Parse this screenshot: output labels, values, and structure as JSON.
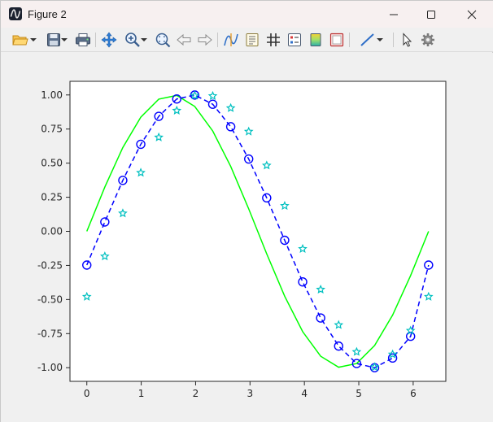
{
  "window": {
    "title": "Figure 2"
  },
  "toolbar": {
    "buttons": [
      {
        "name": "open-file-button",
        "icon": "folder-open-icon",
        "dropdown": true
      },
      {
        "name": "save-button",
        "icon": "floppy-disk-icon",
        "dropdown": true
      },
      {
        "name": "print-button",
        "icon": "printer-icon",
        "dropdown": false
      },
      {
        "name": "pan-button",
        "icon": "pan-arrows-icon",
        "dropdown": false
      },
      {
        "name": "zoom-in-button",
        "icon": "zoom-in-icon",
        "dropdown": true
      },
      {
        "name": "zoom-fit-button",
        "icon": "zoom-fit-icon",
        "dropdown": false
      },
      {
        "name": "back-button",
        "icon": "arrow-left-icon",
        "dropdown": false
      },
      {
        "name": "forward-button",
        "icon": "arrow-right-icon",
        "dropdown": false
      },
      {
        "name": "data-cursor-button",
        "icon": "data-cursor-icon",
        "dropdown": false
      },
      {
        "name": "list-button",
        "icon": "list-icon",
        "dropdown": false
      },
      {
        "name": "grid-button",
        "icon": "grid-icon",
        "dropdown": false
      },
      {
        "name": "legend-button",
        "icon": "legend-icon",
        "dropdown": false
      },
      {
        "name": "colorbar-button",
        "icon": "colorbar-icon",
        "dropdown": false
      },
      {
        "name": "axes-box-button",
        "icon": "axes-box-icon",
        "dropdown": false
      },
      {
        "name": "line-style-button",
        "icon": "line-icon",
        "dropdown": true
      },
      {
        "name": "select-button",
        "icon": "pointer-icon",
        "dropdown": false
      },
      {
        "name": "settings-button",
        "icon": "gear-icon",
        "dropdown": false
      }
    ]
  },
  "chart_data": {
    "type": "line",
    "title": "",
    "xlabel": "",
    "ylabel": "",
    "xlim": [
      -0.31,
      6.6
    ],
    "ylim": [
      -1.1,
      1.1
    ],
    "x_ticks": [
      0,
      1,
      2,
      3,
      4,
      5,
      6
    ],
    "x_tick_labels": [
      "0",
      "1",
      "2",
      "3",
      "4",
      "5",
      "6"
    ],
    "y_ticks": [
      1.0,
      0.75,
      0.5,
      0.25,
      0.0,
      -0.25,
      -0.5,
      -0.75,
      -1.0
    ],
    "y_tick_labels": [
      "1.00",
      "0.75",
      "0.50",
      "0.25",
      "0.00",
      "-0.25",
      "-0.50",
      "-0.75",
      "-1.00"
    ],
    "grid": false,
    "x": [
      0,
      0.3307,
      0.6614,
      0.9921,
      1.3228,
      1.6535,
      1.9842,
      2.3149,
      2.6456,
      2.9762,
      3.3069,
      3.6376,
      3.9683,
      4.299,
      4.6297,
      4.9604,
      5.2911,
      5.6218,
      5.9525,
      6.2832
    ],
    "series": [
      {
        "style": "solid-line",
        "color": "#00ff00",
        "values": [
          0.0,
          0.3247,
          0.6142,
          0.8372,
          0.9694,
          0.9966,
          0.9158,
          0.7357,
          0.4759,
          0.1646,
          -0.1646,
          -0.4759,
          -0.7357,
          -0.9158,
          -0.9966,
          -0.9694,
          -0.8372,
          -0.6142,
          -0.3247,
          0.0
        ]
      },
      {
        "style": "dashed-line-circle-markers",
        "color": "#0000ff",
        "values": [
          -0.2474,
          0.0686,
          0.3739,
          0.6382,
          0.8433,
          0.9705,
          0.9994,
          0.9318,
          0.767,
          0.5304,
          0.2453,
          -0.0656,
          -0.3706,
          -0.6355,
          -0.8414,
          -0.9695,
          -1.0,
          -0.929,
          -0.7697,
          -0.2474
        ]
      },
      {
        "style": "star-markers",
        "color": "#00c0c0",
        "values": [
          -0.4794,
          -0.1834,
          0.132,
          0.4299,
          0.6892,
          0.8855,
          0.9959,
          0.9926,
          0.9041,
          0.7315,
          0.4831,
          0.1867,
          -0.1286,
          -0.4268,
          -0.6867,
          -0.8837,
          -0.9951,
          -0.9018,
          -0.7285,
          -0.4794
        ]
      }
    ]
  }
}
